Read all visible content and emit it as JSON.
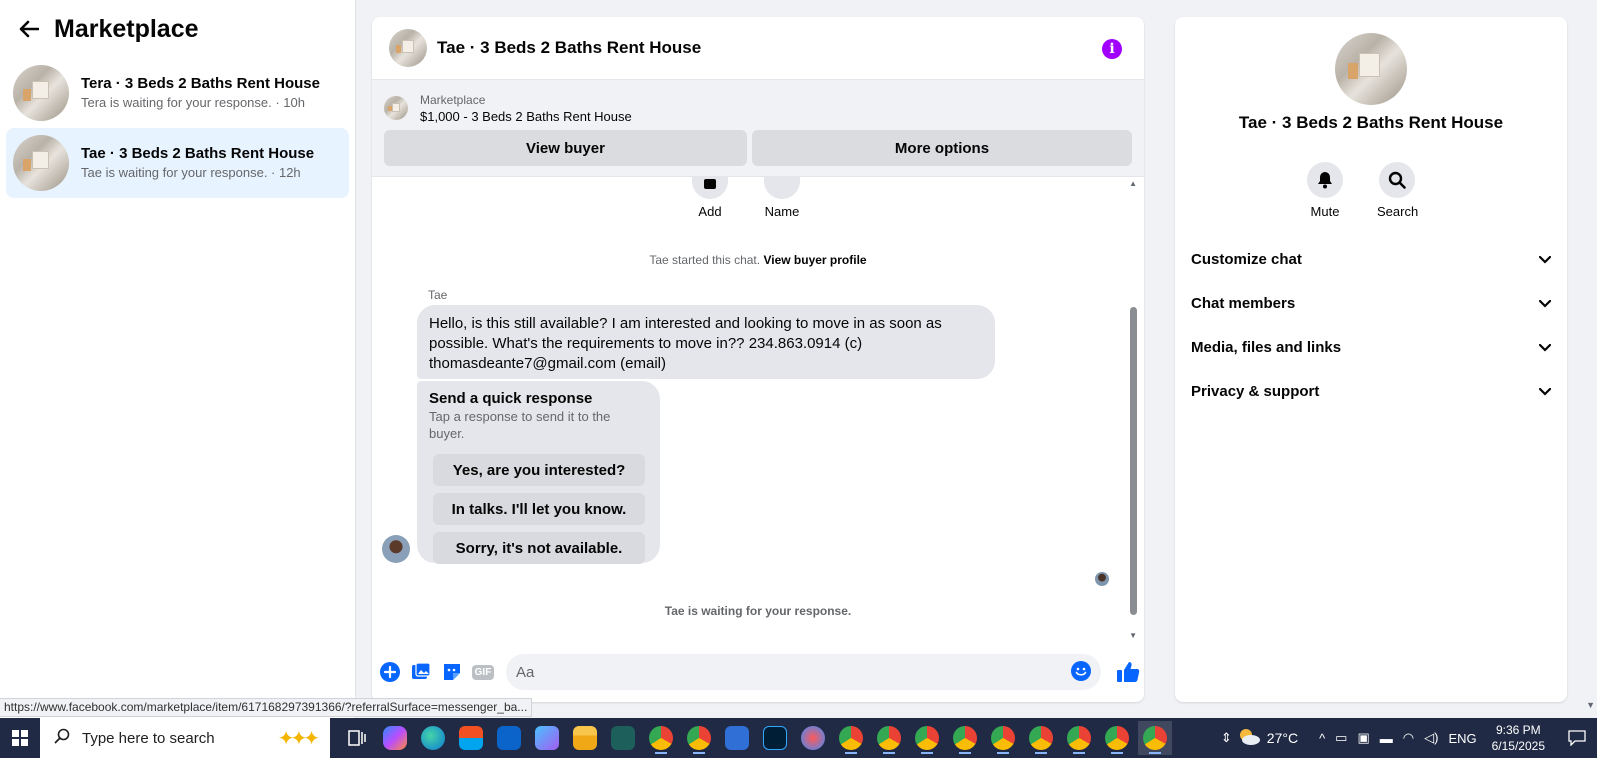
{
  "sidebar": {
    "title": "Marketplace",
    "conversations": [
      {
        "title": "Tera · 3 Beds 2 Baths Rent House",
        "subtitle": "Tera is waiting for your response. · 10h",
        "active": false
      },
      {
        "title": "Tae · 3 Beds 2 Baths Rent House",
        "subtitle": "Tae is waiting for your response. · 12h",
        "active": true
      }
    ]
  },
  "chat": {
    "title": "Tae · 3 Beds 2 Baths Rent House",
    "marketplace": {
      "label": "Marketplace",
      "item": "$1,000 - 3 Beds 2 Baths Rent House",
      "view_buyer": "View buyer",
      "more_options": "More options"
    },
    "actions": {
      "add": "Add",
      "name": "Name"
    },
    "started_text": "Tae started this chat.",
    "view_profile": "View buyer profile",
    "sender": "Tae",
    "message": "Hello, is this still available? I am interested and looking to move in as soon as possible. What's the requirements to move in?? 234.863.0914 (c) thomasdeante7@gmail.com (email)",
    "quick_response": {
      "title": "Send a quick response",
      "subtitle": "Tap a response to send it to the buyer.",
      "options": [
        "Yes, are you interested?",
        "In talks. I'll let you know.",
        "Sorry, it's not available."
      ]
    },
    "waiting": "Tae is waiting for your response.",
    "composer": {
      "placeholder": "Aa",
      "value": ""
    }
  },
  "info": {
    "title": "Tae · 3 Beds 2 Baths Rent House",
    "mute": "Mute",
    "search": "Search",
    "sections": [
      "Customize chat",
      "Chat members",
      "Media, files and links",
      "Privacy & support"
    ]
  },
  "status_url": "https://www.facebook.com/marketplace/item/617168297391366/?referralSurface=messenger_ba...",
  "taskbar": {
    "search_placeholder": "Type here to search",
    "weather": "27°C",
    "language": "ENG",
    "time": "9:36 PM",
    "date": "6/15/2025"
  },
  "colors": {
    "accent": "#0866ff",
    "info_purple": "#a100ff",
    "active_bg": "#e7f3ff",
    "taskbar": "#202a44"
  }
}
